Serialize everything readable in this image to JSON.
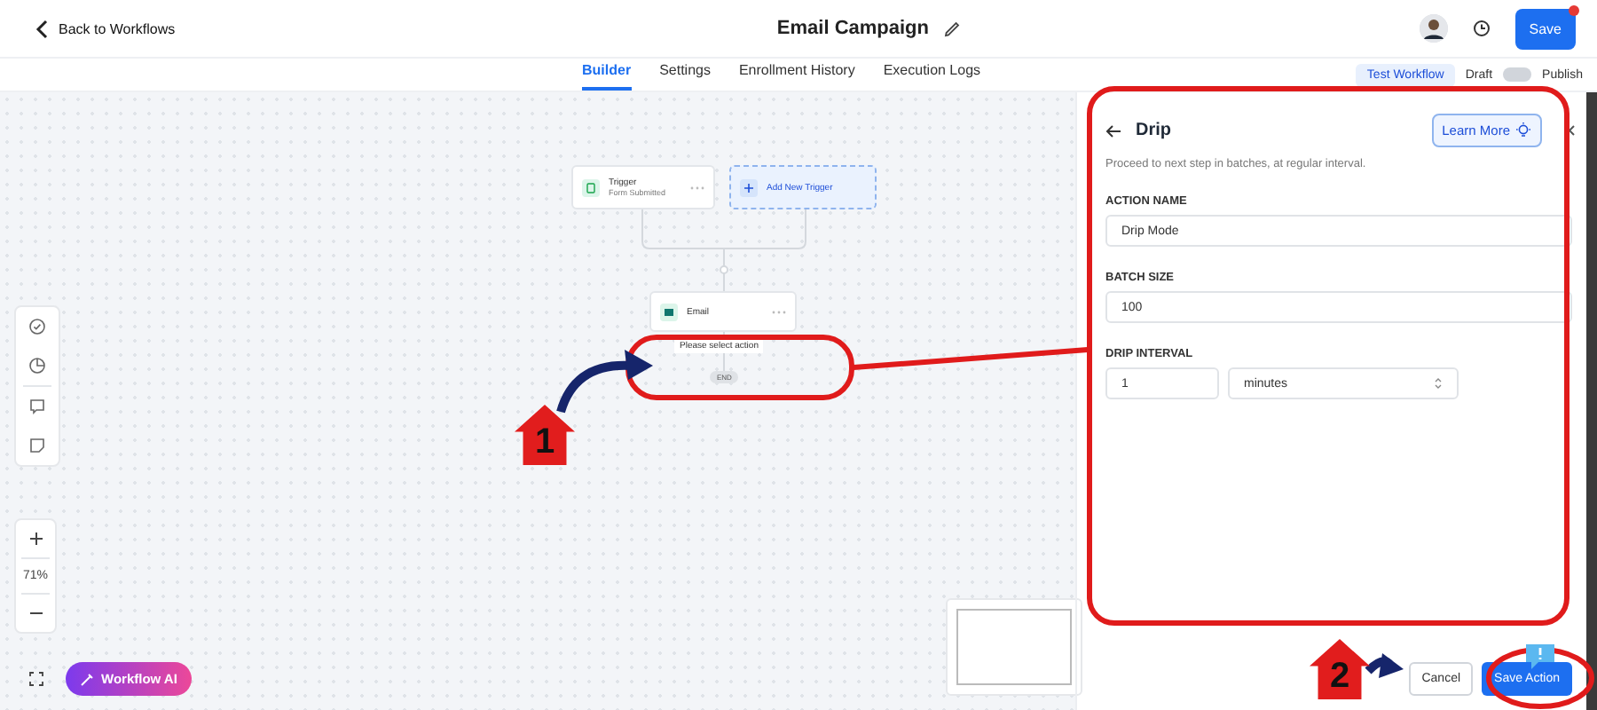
{
  "header": {
    "back_link": "Back to Workflows",
    "title": "Email Campaign",
    "save_button": "Save"
  },
  "tabs": [
    {
      "label": "Builder",
      "selected": true
    },
    {
      "label": "Settings",
      "selected": false
    },
    {
      "label": "Enrollment History",
      "selected": false
    },
    {
      "label": "Execution Logs",
      "selected": false
    }
  ],
  "header_actions": {
    "test_button": "Test Workflow",
    "draft_label": "Draft",
    "publish_on": false,
    "publish_label": "Publish"
  },
  "canvas": {
    "nodes": [
      {
        "kind": "trigger",
        "title": "Trigger",
        "subtitle": "Form Submitted"
      },
      {
        "kind": "add",
        "title": "Add New Trigger"
      },
      {
        "kind": "action",
        "title": "Email"
      }
    ],
    "placeholder_text": "Please select action",
    "end_label": "END",
    "zoom": "71%",
    "ai_button": "Workflow AI"
  },
  "panel": {
    "title": "Drip",
    "learn_more": "Learn More",
    "description": "Proceed to next step in batches, at regular interval.",
    "fields": [
      {
        "label": "ACTION NAME",
        "value": "Drip Mode"
      },
      {
        "label": "BATCH SIZE",
        "value": "100"
      }
    ],
    "interval": {
      "label": "DRIP INTERVAL",
      "value": "1",
      "unit": "minutes"
    },
    "cancel_button": "Cancel",
    "save_button": "Save Action"
  },
  "annotations": [
    {
      "kind": "badge",
      "number": "1"
    },
    {
      "kind": "badge",
      "number": "2"
    }
  ]
}
